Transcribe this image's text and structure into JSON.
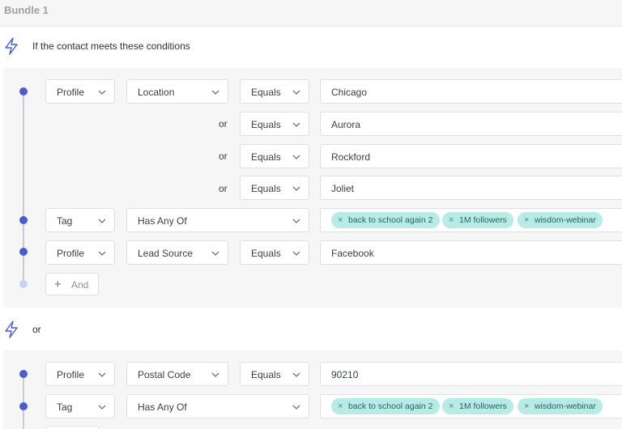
{
  "bundle": {
    "title": "Bundle 1"
  },
  "condition_header": "If the contact meets these conditions",
  "or_label": "or",
  "group1": {
    "rows": [
      {
        "category": "Profile",
        "field": "Location",
        "operator": "Equals",
        "value": "Chicago"
      },
      {
        "connector": "or",
        "operator": "Equals",
        "value": "Aurora"
      },
      {
        "connector": "or",
        "operator": "Equals",
        "value": "Rockford"
      },
      {
        "connector": "or",
        "operator": "Equals",
        "value": "Joliet"
      },
      {
        "category": "Tag",
        "field": "Has Any Of",
        "tags": [
          "back to school again 2",
          "1M followers",
          "wisdom-webinar"
        ]
      },
      {
        "category": "Profile",
        "field": "Lead Source",
        "operator": "Equals",
        "value": "Facebook"
      }
    ],
    "and_button": "And"
  },
  "group2": {
    "rows": [
      {
        "category": "Profile",
        "field": "Postal Code",
        "operator": "Equals",
        "value": "90210"
      },
      {
        "category": "Tag",
        "field": "Has Any Of",
        "tags": [
          "back to school again 2",
          "1M followers",
          "wisdom-webinar"
        ]
      }
    ]
  },
  "icons": {
    "condition": "lightning-bolt-icon",
    "dropdown": "chevron-down-icon",
    "remove": "close-icon",
    "add": "plus-icon"
  },
  "colors": {
    "accent": "#4a5bd4",
    "tag_bg": "#b8ebe6",
    "tag_text": "#26635e",
    "panel_bg": "#f6f6f7"
  }
}
